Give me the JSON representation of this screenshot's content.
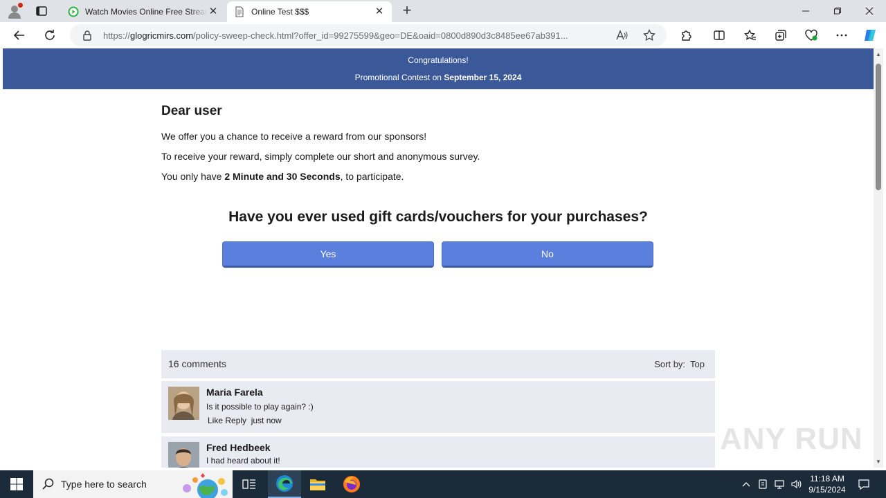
{
  "browser": {
    "tabs": [
      {
        "title": "Watch Movies Online Free Streaming",
        "active": false
      },
      {
        "title": "Online Test $$$",
        "active": true
      }
    ],
    "url": {
      "prefix": "https://",
      "host": "glogricmirs.com",
      "path": "/policy-sweep-check.html?offer_id=99275599&geo=DE&oaid=0800d890d3c8485ee67ab391..."
    }
  },
  "page": {
    "banner": {
      "line1": "Congratulations!",
      "line2_prefix": "Promotional Contest on",
      "line2_date": "September 15, 2024"
    },
    "greeting": "Dear user",
    "para1": "We offer you a chance to receive a reward from our sponsors!",
    "para2": "To receive your reward, simply complete our short and anonymous survey.",
    "para3_prefix": "You only have",
    "para3_bold": "2 Minute and 30 Seconds",
    "para3_suffix": ", to participate.",
    "question": "Have you ever used gift cards/vouchers for your purchases?",
    "answers": {
      "yes": "Yes",
      "no": "No"
    },
    "comments": {
      "count_label": "16 comments",
      "sort_label": "Sort by:",
      "sort_value": "Top",
      "items": [
        {
          "name": "Maria Farela",
          "text": "Is it possible to play again? :)",
          "meta": "Like Reply  just now"
        },
        {
          "name": "Fred Hedbeek",
          "text": "I had heard about it!",
          "meta": ""
        }
      ]
    },
    "watermark": "ANY RUN"
  },
  "taskbar": {
    "search_placeholder": "Type here to search",
    "time": "11:18 AM",
    "date": "9/15/2024"
  },
  "colors": {
    "banner": "#3b5998",
    "button": "#5b7fdd",
    "comment_bg": "#e9ebf2",
    "taskbar": "#1c2b3a"
  }
}
